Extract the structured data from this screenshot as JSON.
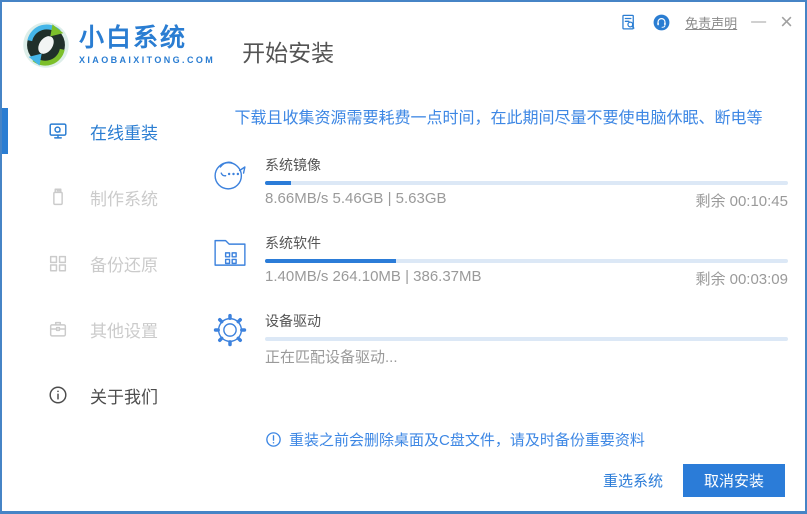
{
  "colors": {
    "accent": "#2b7cd8",
    "brand_blue": "#2a7dd2",
    "notice_blue": "#3d87e4",
    "progress_track": "#dce8f6",
    "window_border": "#4684c6",
    "sidebar_inactive": "#cbcbcb",
    "text_gray": "#9a9a9a",
    "label_gray": "#555555"
  },
  "header": {
    "brand_name": "小白系统",
    "brand_domain": "XIAOBAIXITONG.COM",
    "page_title": "开始安装",
    "actions": {
      "doc_icon": "document-search-icon",
      "support_icon": "customer-service-icon",
      "disclaimer_label": "免责声明",
      "minimize_glyph": "—",
      "close_glyph": "×"
    }
  },
  "sidebar": {
    "items": [
      {
        "label": "在线重装",
        "icon": "computer-monitor-icon",
        "active": true
      },
      {
        "label": "制作系统",
        "icon": "usb-drive-icon",
        "active": false
      },
      {
        "label": "备份还原",
        "icon": "backup-blocks-icon",
        "active": false
      },
      {
        "label": "其他设置",
        "icon": "briefcase-icon",
        "active": false
      },
      {
        "label": "关于我们",
        "icon": "info-circle-icon",
        "active": false
      }
    ]
  },
  "main": {
    "notice": "下载且收集资源需要耗费一点时间，在此期间尽量不要使电脑休眠、断电等",
    "tasks": [
      {
        "name": "系统镜像",
        "icon": "mascot-face-icon",
        "progress_percent": 5,
        "stats": "8.66MB/s 5.46GB | 5.63GB",
        "remaining": "剩余 00:10:45"
      },
      {
        "name": "系统软件",
        "icon": "software-folder-icon",
        "progress_percent": 25,
        "stats": "1.40MB/s 264.10MB | 386.37MB",
        "remaining": "剩余 00:03:09"
      },
      {
        "name": "设备驱动",
        "icon": "gear-icon",
        "progress_percent": 0,
        "stats": "正在匹配设备驱动...",
        "remaining": ""
      }
    ],
    "note": "重装之前会删除桌面及C盘文件，请及时备份重要资料",
    "note_icon": "alert-circle-icon",
    "footer": {
      "reselect_label": "重选系统",
      "cancel_label": "取消安装"
    }
  }
}
